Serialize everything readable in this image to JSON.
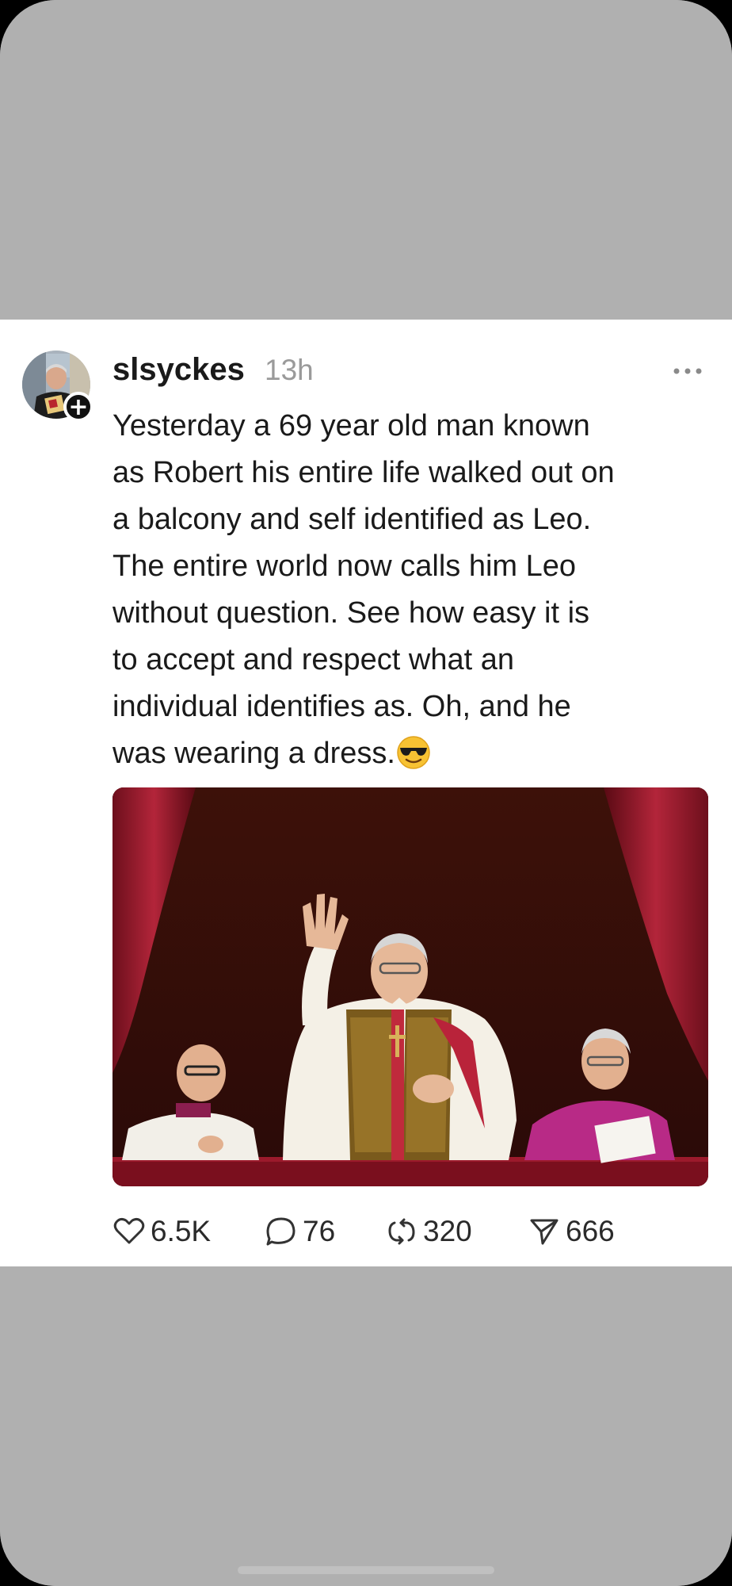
{
  "post": {
    "username": "slsyckes",
    "timestamp": "13h",
    "more_icon": "more-dots-icon",
    "text": "Yesterday a 69 year old man known\nas Robert his entire life walked out on\na balcony and self identified as Leo.\nThe entire world now calls him Leo\nwithout question. See how easy it is\nto accept and respect what an\nindividual identifies as. Oh, and he\nwas wearing a dress.",
    "emoji": "smiling-face-with-sunglasses",
    "image": "photo of a man in papal vestments waving from a balcony with red drapes, flanked by two clergymen"
  },
  "actions": {
    "likes": "6.5K",
    "replies": "76",
    "reposts": "320",
    "shares": "666"
  },
  "colors": {
    "background_gray": "#b0b0b0",
    "post_background": "#ffffff",
    "text_primary": "#1a1a1a",
    "text_secondary": "#9a9a9a",
    "drape_red": "#8a1524"
  }
}
